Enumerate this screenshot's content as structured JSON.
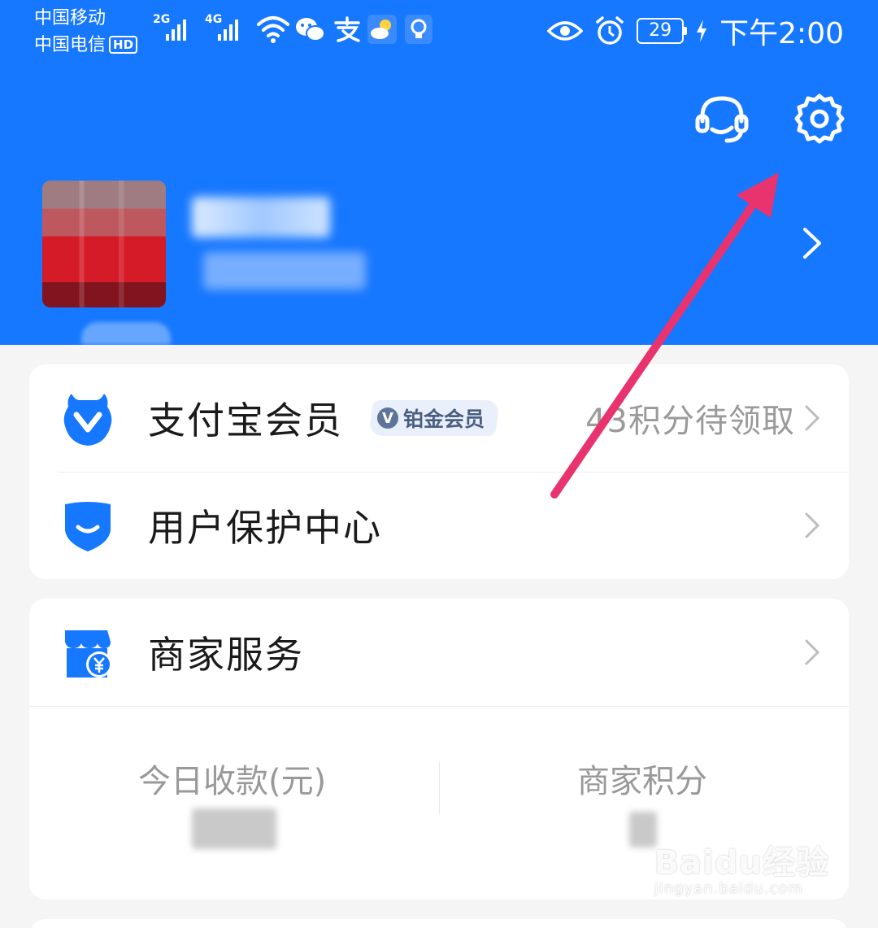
{
  "status_bar": {
    "carrier1": "中国移动",
    "carrier2": "中国电信",
    "hd": "HD",
    "net1": "2G",
    "net2": "4G",
    "battery": "29",
    "time": "下午2:00"
  },
  "header": {
    "customer_service_icon": "headset-icon",
    "settings_icon": "gear-icon",
    "accent": "#1677ff"
  },
  "member": {
    "label": "支付宝会员",
    "badge": "铂金会员",
    "right_text": "43积分待领取"
  },
  "protection": {
    "label": "用户保护中心"
  },
  "merchant": {
    "label": "商家服务",
    "stats": [
      {
        "label": "今日收款(元)"
      },
      {
        "label": "商家积分"
      }
    ]
  },
  "watermark": {
    "main": "Baidu经验",
    "sub": "jingyan.baidu.com"
  }
}
